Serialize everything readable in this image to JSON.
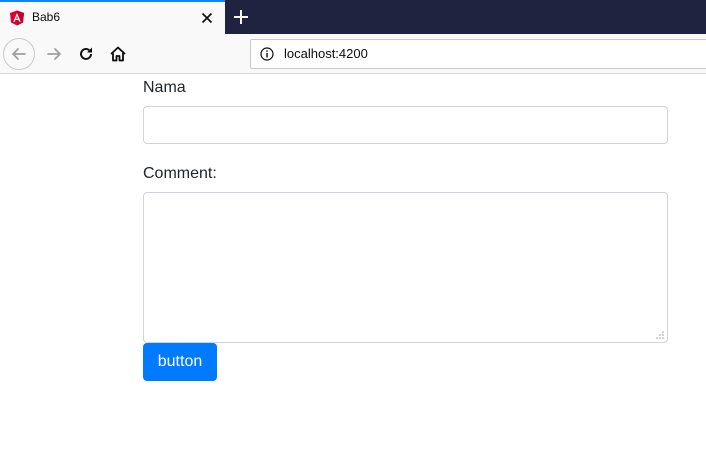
{
  "browser": {
    "tab": {
      "title": "Bab6",
      "favicon": "angular-icon"
    },
    "url": "localhost:4200"
  },
  "form": {
    "nama_label": "Nama",
    "nama_value": "",
    "comment_label": "Comment:",
    "comment_value": "",
    "submit_label": "button"
  },
  "colors": {
    "tabstrip": "#202340",
    "tab_active_top": "#0a84ff",
    "button_primary": "#007bff"
  }
}
